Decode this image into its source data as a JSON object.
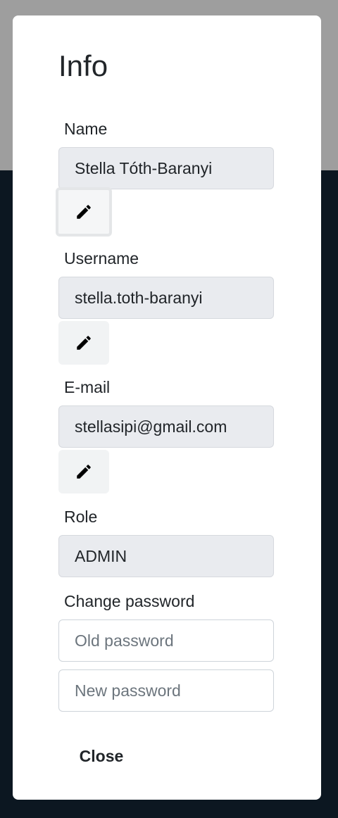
{
  "modal": {
    "title": "Info",
    "name": {
      "label": "Name",
      "value": "Stella Tóth-Baranyi",
      "edit_icon": "pencil-icon"
    },
    "username": {
      "label": "Username",
      "value": "stella.toth-baranyi",
      "edit_icon": "pencil-icon"
    },
    "email": {
      "label": "E-mail",
      "value": "stellasipi@gmail.com",
      "edit_icon": "pencil-icon"
    },
    "role": {
      "label": "Role",
      "value": "ADMIN"
    },
    "password": {
      "label": "Change password",
      "old_placeholder": "Old password",
      "new_placeholder": "New password"
    },
    "close_label": "Close"
  },
  "colors": {
    "backdrop_dark": "#0c1721",
    "backdrop_gray": "#9e9e9e",
    "readonly_field": "#e9ebef",
    "edit_button": "#f1f3f4"
  }
}
